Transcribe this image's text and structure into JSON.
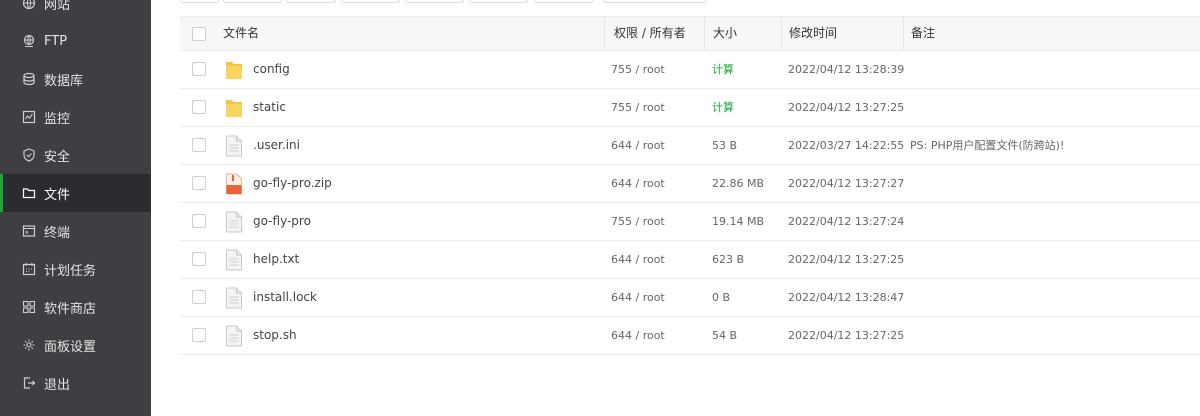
{
  "sidebar": {
    "items": [
      {
        "label": "网站",
        "icon": "globe-icon"
      },
      {
        "label": "FTP",
        "icon": "ftp-globe-icon"
      },
      {
        "label": "数据库",
        "icon": "database-icon"
      },
      {
        "label": "监控",
        "icon": "monitor-icon"
      },
      {
        "label": "安全",
        "icon": "shield-icon"
      },
      {
        "label": "文件",
        "icon": "folder-icon",
        "active": true
      },
      {
        "label": "终端",
        "icon": "terminal-icon"
      },
      {
        "label": "计划任务",
        "icon": "calendar-icon"
      },
      {
        "label": "软件商店",
        "icon": "grid-icon"
      },
      {
        "label": "面板设置",
        "icon": "gear-icon"
      },
      {
        "label": "退出",
        "icon": "logout-icon"
      }
    ]
  },
  "table": {
    "headers": {
      "name": "文件名",
      "perm": "权限 / 所有者",
      "size": "大小",
      "mtime": "修改时间",
      "note": "备注"
    },
    "rows": [
      {
        "type": "folder",
        "name": "config",
        "perm": "755 / root",
        "size": "计算",
        "mtime": "2022/04/12 13:28:39",
        "note": ""
      },
      {
        "type": "folder",
        "name": "static",
        "perm": "755 / root",
        "size": "计算",
        "mtime": "2022/04/12 13:27:25",
        "note": ""
      },
      {
        "type": "file",
        "name": ".user.ini",
        "perm": "644 / root",
        "size": "53 B",
        "mtime": "2022/03/27 14:22:55",
        "note": "PS: PHP用户配置文件(防跨站)!"
      },
      {
        "type": "zip",
        "name": "go-fly-pro.zip",
        "perm": "644 / root",
        "size": "22.86 MB",
        "mtime": "2022/04/12 13:27:27",
        "note": ""
      },
      {
        "type": "file",
        "name": "go-fly-pro",
        "perm": "755 / root",
        "size": "19.14 MB",
        "mtime": "2022/04/12 13:27:24",
        "note": ""
      },
      {
        "type": "file",
        "name": "help.txt",
        "perm": "644 / root",
        "size": "623 B",
        "mtime": "2022/04/12 13:27:25",
        "note": ""
      },
      {
        "type": "file",
        "name": "install.lock",
        "perm": "644 / root",
        "size": "0 B",
        "mtime": "2022/04/12 13:28:47",
        "note": ""
      },
      {
        "type": "file",
        "name": "stop.sh",
        "perm": "644 / root",
        "size": "54 B",
        "mtime": "2022/04/12 13:27:25",
        "note": ""
      }
    ]
  },
  "colors": {
    "accent": "#20a53a",
    "sidebar_bg": "#3e3f43",
    "sidebar_active_bg": "#2b2c2f",
    "folder": "#f5c542",
    "zip": "#e8633a"
  }
}
